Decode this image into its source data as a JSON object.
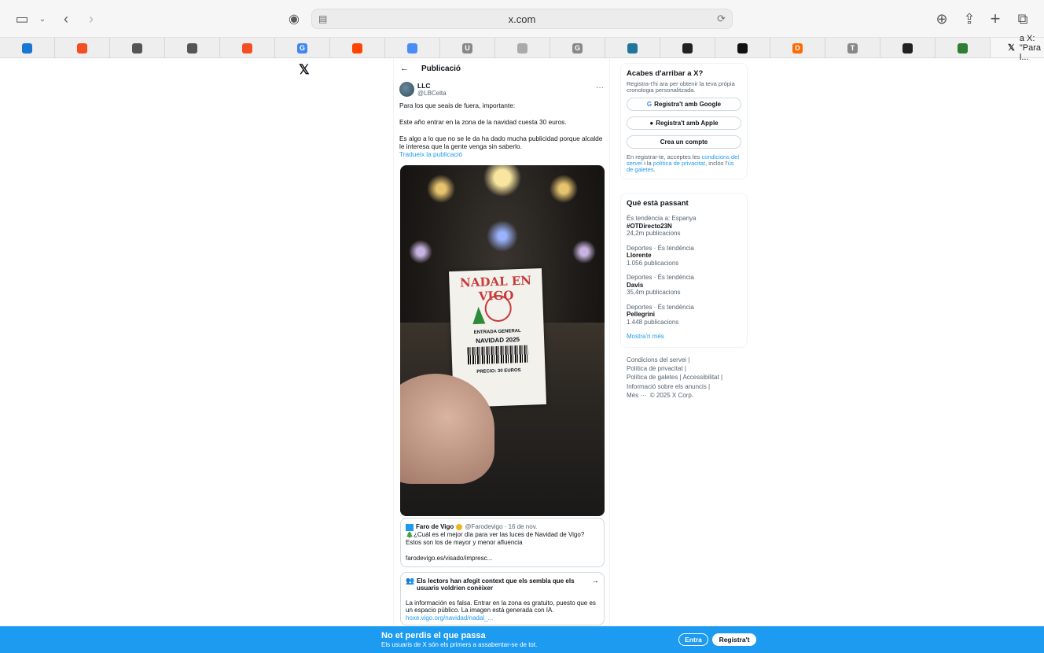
{
  "browser": {
    "url": "x.com",
    "active_tab_title": "a X: \"Para l...",
    "favorites": [
      {
        "icon": "outlook-icon",
        "label": "",
        "color": "#1976d2"
      },
      {
        "icon": "microsoft-icon",
        "label": "",
        "color": "#f25022"
      },
      {
        "icon": "document-search-icon",
        "label": "",
        "color": "#555555"
      },
      {
        "icon": "document-search-icon",
        "label": "",
        "color": "#555555"
      },
      {
        "icon": "microsoft-icon",
        "label": "",
        "color": "#f25022"
      },
      {
        "icon": "google-icon",
        "label": "G",
        "color": "#4285f4"
      },
      {
        "icon": "reddit-icon",
        "label": "",
        "color": "#ff4500"
      },
      {
        "icon": "gemini-icon",
        "label": "",
        "color": "#4b8df8"
      },
      {
        "icon": "u-icon",
        "label": "U",
        "color": "#888888"
      },
      {
        "icon": "figure-icon",
        "label": "",
        "color": "#aaaaaa"
      },
      {
        "icon": "g-icon",
        "label": "G",
        "color": "#888888"
      },
      {
        "icon": "wordpress-icon",
        "label": "",
        "color": "#21759b"
      },
      {
        "icon": "instagram-icon",
        "label": "",
        "color": "#222222"
      },
      {
        "icon": "ny-icon",
        "label": "",
        "color": "#111111"
      },
      {
        "icon": "d-icon",
        "label": "D",
        "color": "#ff6a00"
      },
      {
        "icon": "t-icon",
        "label": "T",
        "color": "#888888"
      },
      {
        "icon": "instagram-icon",
        "label": "",
        "color": "#222222"
      },
      {
        "icon": "app-icon",
        "label": "",
        "color": "#2e7d32"
      }
    ]
  },
  "x": {
    "header_title": "Publicació",
    "author": {
      "name": "LLC",
      "handle": "@LBCelta"
    },
    "post": {
      "p1": "Para los que seais de fuera, importante:",
      "p2": "Este año entrar en la zona de la navidad cuesta 30 euros.",
      "p3": "Es algo a lo que no se le da ha dado mucha publicidad porque alcalde le interesa que la gente venga sin saberlo.",
      "translate": "Tradueix la publicació"
    },
    "photo": {
      "ticket_title": "NADAL EN VIGO",
      "ticket_line1": "ENTRADA GENERAL",
      "ticket_line2": "NAVIDAD 2025",
      "ticket_price": "PRECIO: 30 EUROS"
    },
    "quote": {
      "source": "Faro de Vigo",
      "handle_date": "@Farodevigo · 16 de nov.",
      "text": "🎄¿Cuál es el mejor día para ver las luces de Navidad de Vigo? Estos son los de mayor y menor afluencia",
      "link": "farodevigo.es/visado/impresc..."
    },
    "note": {
      "title": "Els lectors han afegit context que els sembla que els usuaris voldrien conèixer",
      "body": "La información es falsa. Entrar en la zona es gratuito, puesto que es un espacio público. La imagen está generada con IA.",
      "link": "hoxe.vigo.org/navidad/nadal_..."
    },
    "signup": {
      "title": "Acabes d'arribar a X?",
      "subtitle": "Registra-t'hi ara per obtenir la teva pròpia cronologia personalitzada.",
      "google": "Registra't amb Google",
      "apple": "Registra't amb Apple",
      "create": "Crea un compte",
      "terms_1": "En registrar-te, acceptes les ",
      "terms_link1": "condicions del servei",
      "terms_2": " i la ",
      "terms_link2": "política de privacitat",
      "terms_3": ", inclòs l'",
      "terms_link3": "ús de galetes",
      "terms_4": "."
    },
    "trends": {
      "title": "Què està passant",
      "items": [
        {
          "context": "És tendència a: Espanya",
          "name": "#OTDirecto23N",
          "count": "24,2m publicacions"
        },
        {
          "context": "Deportes · És tendència",
          "name": "Llorente",
          "count": "1.056 publicacions"
        },
        {
          "context": "Deportes · És tendència",
          "name": "Davis",
          "count": "35,4m publicacions"
        },
        {
          "context": "Deportes · És tendència",
          "name": "Pellegrini",
          "count": "1.448 publicacions"
        }
      ],
      "more": "Mostra'n més"
    },
    "footer": {
      "l1": "Condicions del servei",
      "l2": "Política de privacitat",
      "l3": "Política de galetes",
      "l4": "Accessibilitat",
      "l5": "Informació sobre els anuncis",
      "l6": "Més ···",
      "copyright": "© 2025 X Corp."
    },
    "banner": {
      "title": "No et perdis el que passa",
      "subtitle": "Els usuaris de X són els primers a assabentar-se de tot.",
      "login": "Entra",
      "register": "Registra't"
    }
  }
}
